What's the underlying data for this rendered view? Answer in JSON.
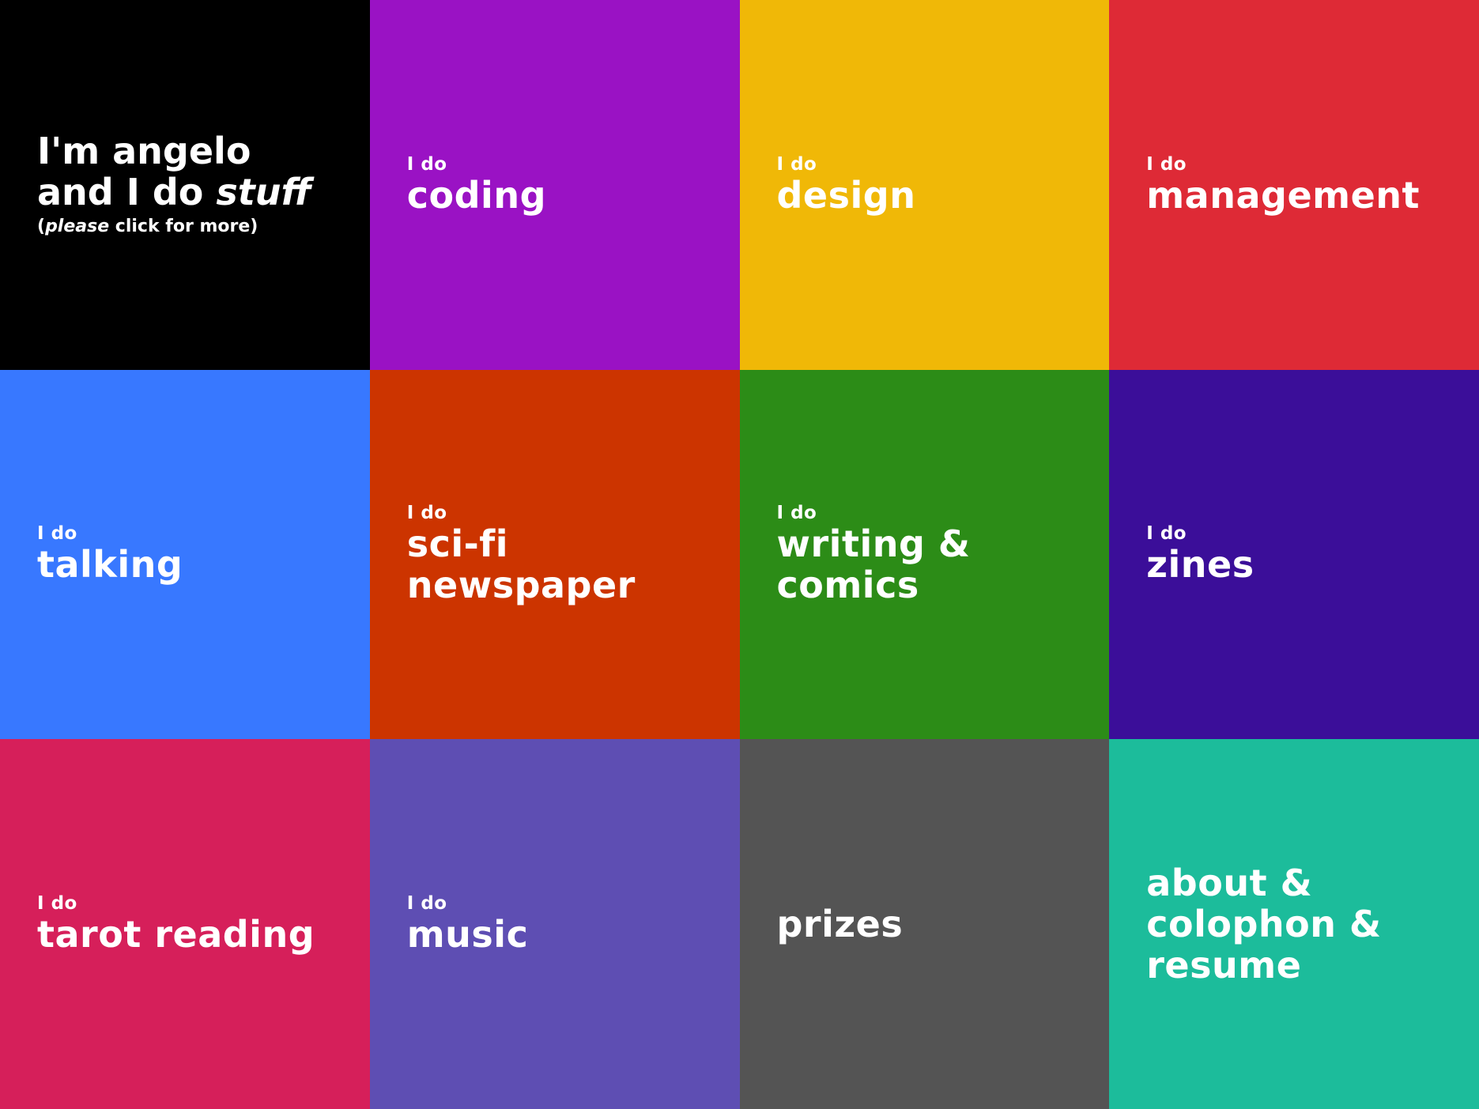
{
  "intro": {
    "line1": "I'm angelo",
    "line2_start": "and I do ",
    "line2_em": "stuff",
    "sub_open": "(",
    "sub_em": "please",
    "sub_rest": " click for more)",
    "color": "#000000"
  },
  "tiles": [
    {
      "pre": "I do",
      "lines": [
        "coding"
      ],
      "color": "#9a12c4"
    },
    {
      "pre": "I do",
      "lines": [
        "design"
      ],
      "color": "#f0b807"
    },
    {
      "pre": "I do",
      "lines": [
        "management"
      ],
      "color": "#de2a36"
    },
    {
      "pre": "I do",
      "lines": [
        "talking"
      ],
      "color": "#3878ff"
    },
    {
      "pre": "I do",
      "lines": [
        "sci-fi",
        "newspaper"
      ],
      "color": "#cc3400"
    },
    {
      "pre": "I do",
      "lines": [
        "writing &",
        "comics"
      ],
      "color": "#2c8c17"
    },
    {
      "pre": "I do",
      "lines": [
        "zines"
      ],
      "color": "#3b0e99"
    },
    {
      "pre": "I do",
      "lines": [
        "tarot reading"
      ],
      "color": "#d61f5a"
    },
    {
      "pre": "I do",
      "lines": [
        "music"
      ],
      "color": "#5e4eb3"
    },
    {
      "pre": "",
      "lines": [
        "prizes"
      ],
      "color": "#545454"
    },
    {
      "pre": "",
      "lines": [
        "about &",
        "colophon &",
        "resume"
      ],
      "color": "#1cbc9b"
    }
  ]
}
